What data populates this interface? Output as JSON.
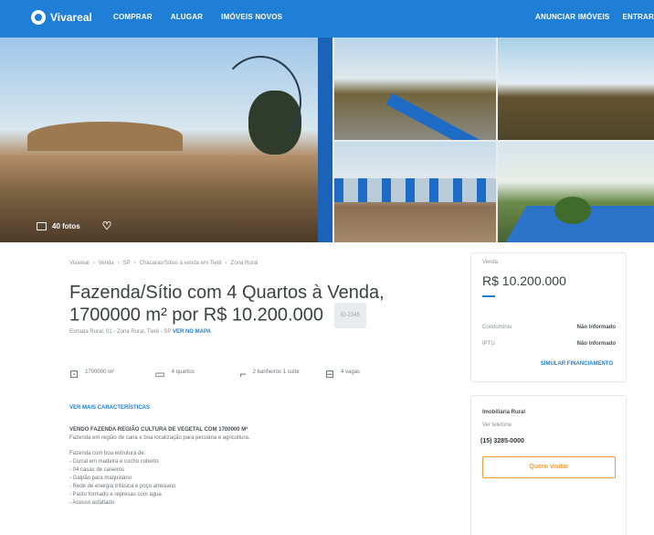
{
  "header": {
    "logo_text": "Vivareal",
    "nav": [
      "COMPRAR",
      "ALUGAR",
      "IMÓVEIS NOVOS"
    ],
    "nav_right": [
      "ANUNCIAR IMÓVEIS",
      "ENTRAR"
    ]
  },
  "gallery": {
    "photo_count_label": "40 fotos"
  },
  "breadcrumb": [
    "Vivareal",
    "Venda",
    "SP",
    "Chácaras/Sítios à venda em Tietê",
    "Zona Rural"
  ],
  "listing": {
    "title": "Fazenda/Sítio com 4 Quartos à Venda, 1700000 m² por R$ 10.200.000",
    "code": "ID-2345",
    "address_prefix": "Estrada Rural, 01 - Zona Rural, Tietê - SP",
    "address_link": "VER NO MAPA"
  },
  "features": [
    {
      "icon": "area-icon",
      "label": "1700000 m²"
    },
    {
      "icon": "bed-icon",
      "label": "4 quartos"
    },
    {
      "icon": "bath-icon",
      "label": "2 banheiros 1 suíte"
    },
    {
      "icon": "garage-icon",
      "label": "4 vagas"
    }
  ],
  "details_link": "VER MAIS CARACTERÍSTICAS",
  "description": {
    "heading": "VENDO FAZENDA REGIÃO CULTURA DE VEGETAL COM 1700000 M²",
    "subheading": "Fazenda em região de cana e boa localização para pecuária e agricultura.",
    "lines": [
      "Fazenda com boa estrutura de:",
      "- Curral em madeira e cocho coberto",
      "- 04 casas de caseiros",
      "- Galpão para maquinário",
      "- Rede de energia trifásica e poço artesiano",
      "- Pasto formado e represas com água",
      "- Acesso asfaltado"
    ]
  },
  "price_card": {
    "label": "Venda",
    "value": "R$ 10.200.000",
    "rows": [
      {
        "label": "Condomínio",
        "value": "Não informado"
      },
      {
        "label": "IPTU",
        "value": "Não informado"
      }
    ],
    "link": "SIMULAR FINANCIAMENTO"
  },
  "contact_card": {
    "name": "Imobiliária Rural",
    "sub": "Ver telefone",
    "phone": "(15) 3285-0000",
    "button": "Quero visitar"
  },
  "colors": {
    "brand": "#1f7fd6",
    "accent": "#f39a3e"
  }
}
